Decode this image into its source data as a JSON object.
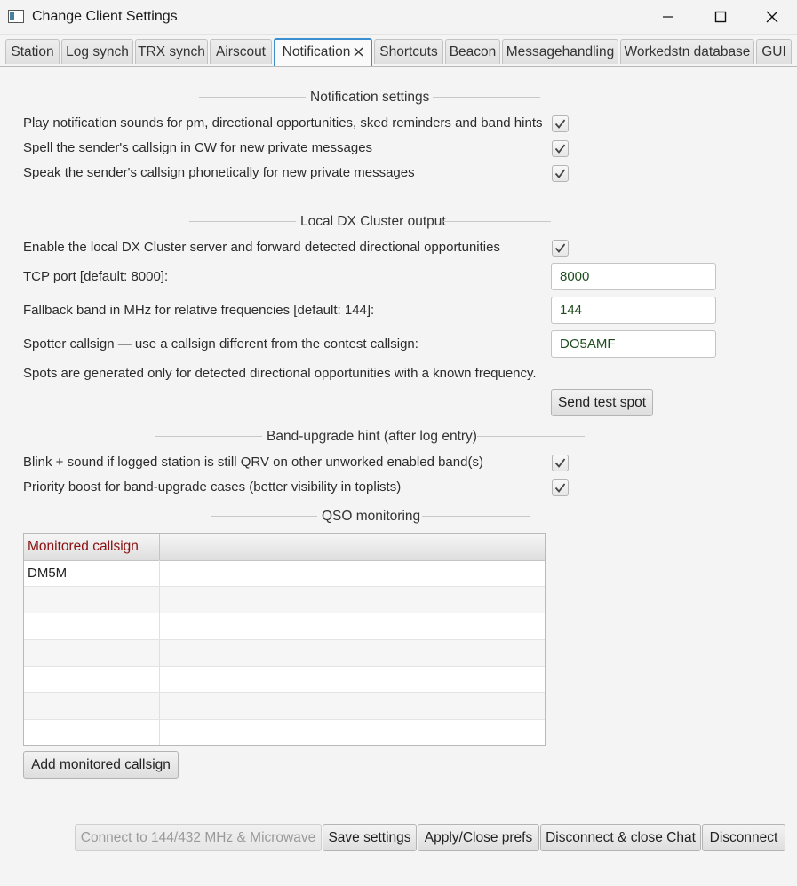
{
  "window": {
    "title": "Change Client Settings"
  },
  "tabs": [
    {
      "label": "Station"
    },
    {
      "label": "Log synch"
    },
    {
      "label": "TRX synch"
    },
    {
      "label": "Airscout"
    },
    {
      "label": "Notification"
    },
    {
      "label": "Shortcuts"
    },
    {
      "label": "Beacon"
    },
    {
      "label": "Messagehandling"
    },
    {
      "label": "Workedstn database"
    },
    {
      "label": "GUI"
    }
  ],
  "notification": {
    "title": "Notification settings",
    "items": [
      {
        "label": "Play notification sounds for pm, directional opportunities, sked reminders and band hints",
        "checked": true
      },
      {
        "label": "Spell the sender's callsign in CW for new private messages",
        "checked": true
      },
      {
        "label": "Speak the sender's callsign phonetically for new private messages",
        "checked": true
      }
    ]
  },
  "dxcluster": {
    "title": "Local DX Cluster output",
    "enable_label": "Enable the local DX Cluster server and forward detected directional opportunities",
    "enable_checked": true,
    "tcp_label": "TCP port [default: 8000]:",
    "tcp_value": "8000",
    "fallback_label": "Fallback band in MHz for relative frequencies [default: 144]:",
    "fallback_value": "144",
    "spotter_label": "Spotter callsign — use a callsign different from the contest callsign:",
    "spotter_value": "DO5AMF",
    "info": "Spots are generated only for detected directional opportunities with a known frequency.",
    "test_button": "Send test spot"
  },
  "bandupgrade": {
    "title": "Band-upgrade hint (after log entry)",
    "items": [
      {
        "label": "Blink + sound if logged station is still QRV on other unworked enabled band(s)",
        "checked": true
      },
      {
        "label": "Priority boost for band-upgrade cases (better visibility in toplists)",
        "checked": true
      }
    ]
  },
  "qso_monitoring": {
    "title": "QSO monitoring",
    "column_header": "Monitored callsign",
    "rows": [
      "DM5M",
      "",
      "",
      "",
      "",
      "",
      ""
    ],
    "add_button": "Add monitored callsign"
  },
  "footer": {
    "connect": "Connect to 144/432 MHz & Microwave",
    "save": "Save settings",
    "apply": "Apply/Close prefs",
    "disconnect_close": "Disconnect & close Chat",
    "disconnect": "Disconnect"
  },
  "colors": {
    "accent": "#3c8fcf",
    "header_text": "#8a1010",
    "field_text": "#1f4d1f"
  }
}
